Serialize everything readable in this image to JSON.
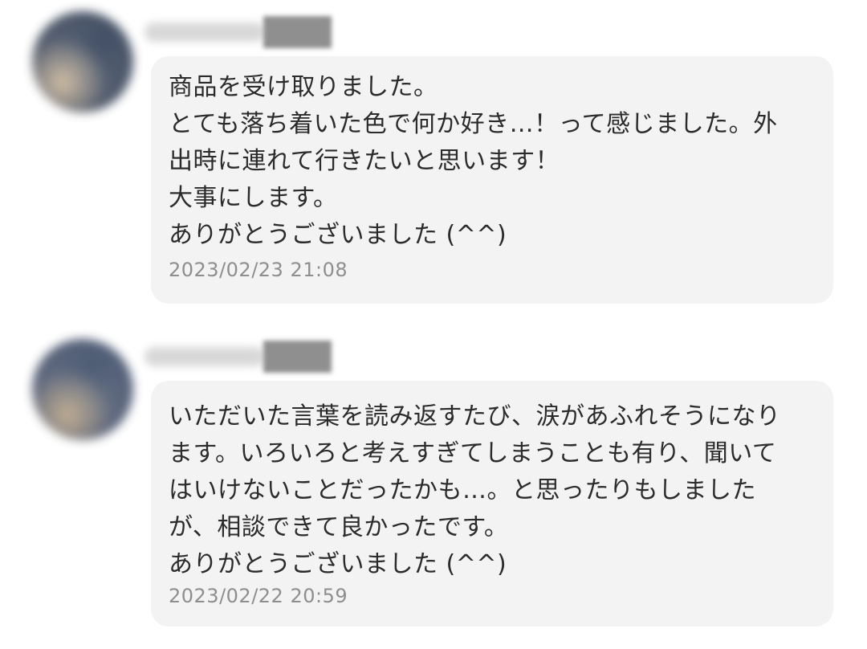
{
  "messages": [
    {
      "text": "商品を受け取りました。\nとても落ち着いた色で何か好き…！って感じました。外\n出時に連れて行きたいと思います！\n大事にします。\nありがとうございました (^^)",
      "timestamp": "2023/02/23 21:08"
    },
    {
      "text": "いただいた言葉を読み返すたび、涙があふれそうになり\nます。いろいろと考えすぎてしまうことも有り、聞いて\nはいけないことだったかも…。と思ったりもしました\nが、相談できて良かったです。\nありがとうございました (^^)",
      "timestamp": "2023/02/22 20:59"
    }
  ]
}
